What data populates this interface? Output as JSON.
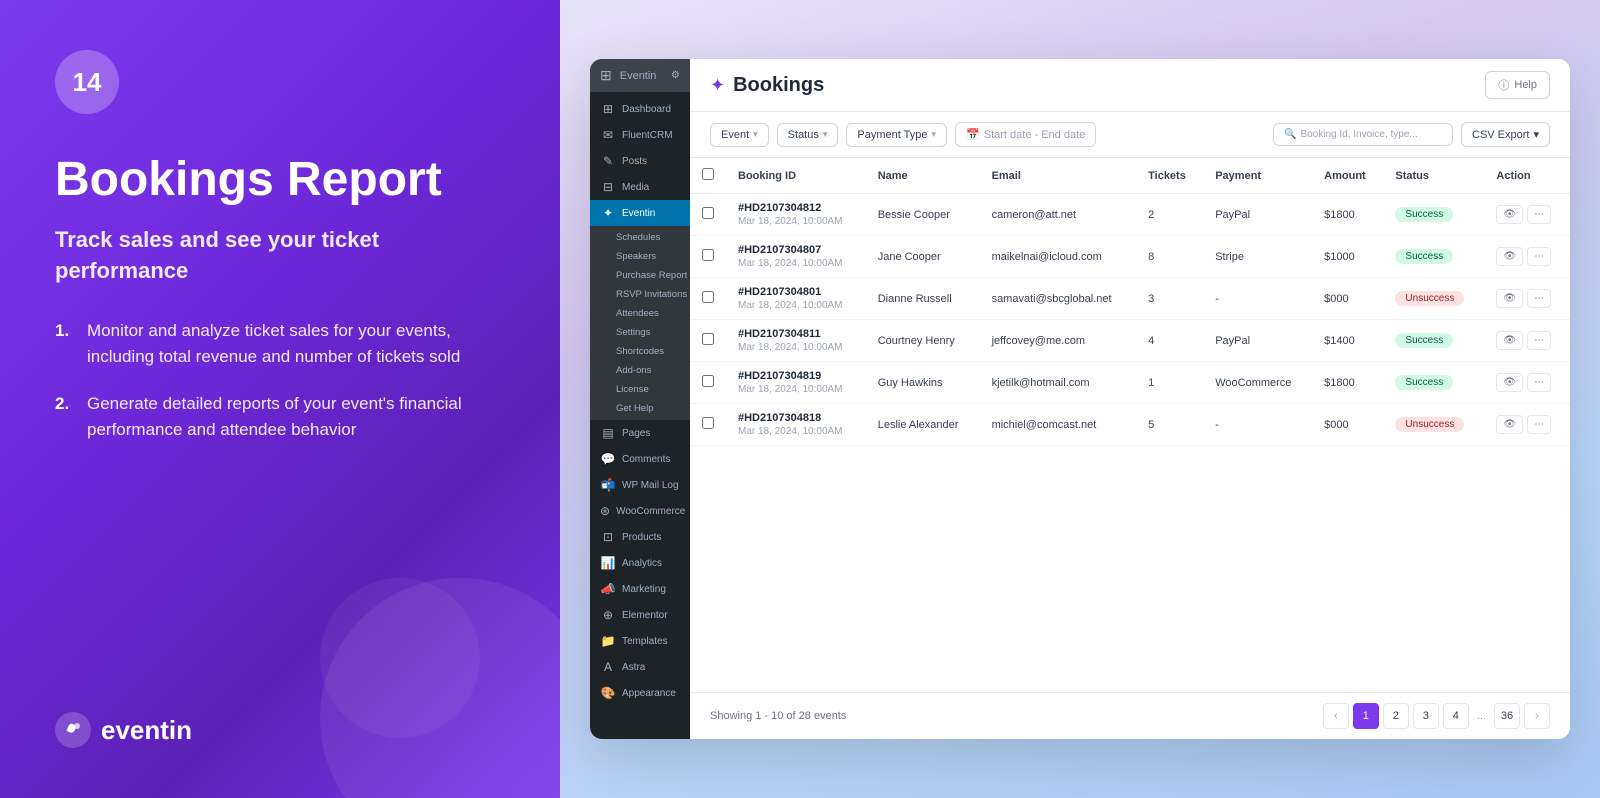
{
  "left": {
    "badge": "14",
    "title": "Bookings Report",
    "subtitle": "Track sales and see your ticket performance",
    "features": [
      "Monitor and analyze ticket sales for your events, including total revenue and number of tickets sold",
      "Generate detailed reports of your event's financial performance and attendee behavior"
    ],
    "brand": "eventin"
  },
  "sidebar": {
    "site_name": "Eventin",
    "menu_items": [
      {
        "label": "Dashboard",
        "icon": "⊞"
      },
      {
        "label": "FluentCRM",
        "icon": "✉"
      },
      {
        "label": "Posts",
        "icon": "📄"
      },
      {
        "label": "Media",
        "icon": "🖼"
      },
      {
        "label": "Eventin",
        "icon": "📅",
        "active": true
      },
      {
        "label": "Pages",
        "icon": "📋"
      },
      {
        "label": "Comments",
        "icon": "💬"
      },
      {
        "label": "WP Mail Log",
        "icon": "📬"
      },
      {
        "label": "WooCommerce",
        "icon": "🛒"
      },
      {
        "label": "Products",
        "icon": "📦"
      },
      {
        "label": "Analytics",
        "icon": "📊"
      },
      {
        "label": "Marketing",
        "icon": "📣"
      },
      {
        "label": "Elementor",
        "icon": "⚡"
      },
      {
        "label": "Templates",
        "icon": "📁"
      },
      {
        "label": "Astra",
        "icon": "A"
      },
      {
        "label": "Appearance",
        "icon": "🎨"
      }
    ],
    "submenu": [
      {
        "label": "Schedules"
      },
      {
        "label": "Speakers"
      },
      {
        "label": "Purchase Report",
        "active": false
      },
      {
        "label": "RSVP Invitations"
      },
      {
        "label": "Attendees"
      },
      {
        "label": "Settings"
      },
      {
        "label": "Shortcodes"
      },
      {
        "label": "Add-ons"
      },
      {
        "label": "License"
      },
      {
        "label": "Get Help"
      }
    ]
  },
  "page": {
    "title": "Bookings",
    "help_label": "Help"
  },
  "filters": {
    "event_label": "Event",
    "status_label": "Status",
    "payment_type_label": "Payment Type",
    "date_placeholder": "Start date - End date",
    "search_placeholder": "Booking Id, Invoice, type...",
    "csv_label": "CSV Export"
  },
  "table": {
    "columns": [
      "Booking ID",
      "Name",
      "Email",
      "Tickets",
      "Payment",
      "Amount",
      "Status",
      "Action"
    ],
    "rows": [
      {
        "id": "#HD2107304812",
        "date": "Mar 18, 2024, 10:00AM",
        "name": "Bessie Cooper",
        "email": "cameron@att.net",
        "tickets": "2",
        "payment": "PayPal",
        "amount": "$1800",
        "status": "Success",
        "status_type": "success"
      },
      {
        "id": "#HD2107304807",
        "date": "Mar 18, 2024, 10:00AM",
        "name": "Jane Cooper",
        "email": "maikelnai@icloud.com",
        "tickets": "8",
        "payment": "Stripe",
        "amount": "$1000",
        "status": "Success",
        "status_type": "success"
      },
      {
        "id": "#HD2107304801",
        "date": "Mar 18, 2024, 10:00AM",
        "name": "Dianne Russell",
        "email": "samavati@sbcglobal.net",
        "tickets": "3",
        "payment": "-",
        "amount": "$000",
        "status": "Unsuccess",
        "status_type": "unsuccess"
      },
      {
        "id": "#HD2107304811",
        "date": "Mar 18, 2024, 10:00AM",
        "name": "Courtney Henry",
        "email": "jeffcovey@me.com",
        "tickets": "4",
        "payment": "PayPal",
        "amount": "$1400",
        "status": "Success",
        "status_type": "success"
      },
      {
        "id": "#HD2107304819",
        "date": "Mar 18, 2024, 10:00AM",
        "name": "Guy Hawkins",
        "email": "kjetilk@hotmail.com",
        "tickets": "1",
        "payment": "WooCommerce",
        "amount": "$1800",
        "status": "Success",
        "status_type": "success"
      },
      {
        "id": "#HD2107304818",
        "date": "Mar 18, 2024, 10:00AM",
        "name": "Leslie Alexander",
        "email": "michiel@comcast.net",
        "tickets": "5",
        "payment": "-",
        "amount": "$000",
        "status": "Unsuccess",
        "status_type": "unsuccess"
      }
    ]
  },
  "pagination": {
    "showing": "Showing 1 - 10 of 28 events",
    "pages": [
      "1",
      "2",
      "3",
      "4",
      "...",
      "36"
    ]
  }
}
